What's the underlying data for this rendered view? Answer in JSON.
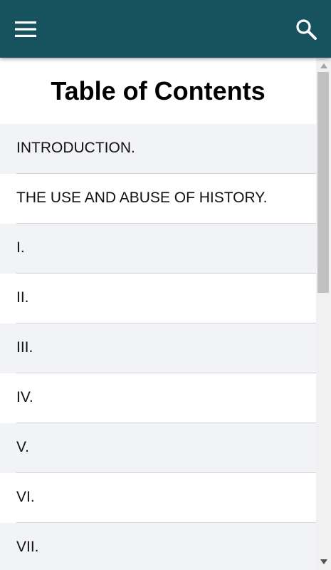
{
  "app_bar": {
    "background": "#17535e",
    "menu_icon": "menu-icon",
    "search_icon": "search-icon"
  },
  "page": {
    "title": "Table of Contents"
  },
  "toc": [
    {
      "label": "INTRODUCTION."
    },
    {
      "label": "THE USE AND ABUSE OF HISTORY."
    },
    {
      "label": "I."
    },
    {
      "label": "II."
    },
    {
      "label": "III."
    },
    {
      "label": "IV."
    },
    {
      "label": "V."
    },
    {
      "label": "VI."
    },
    {
      "label": "VII."
    }
  ]
}
